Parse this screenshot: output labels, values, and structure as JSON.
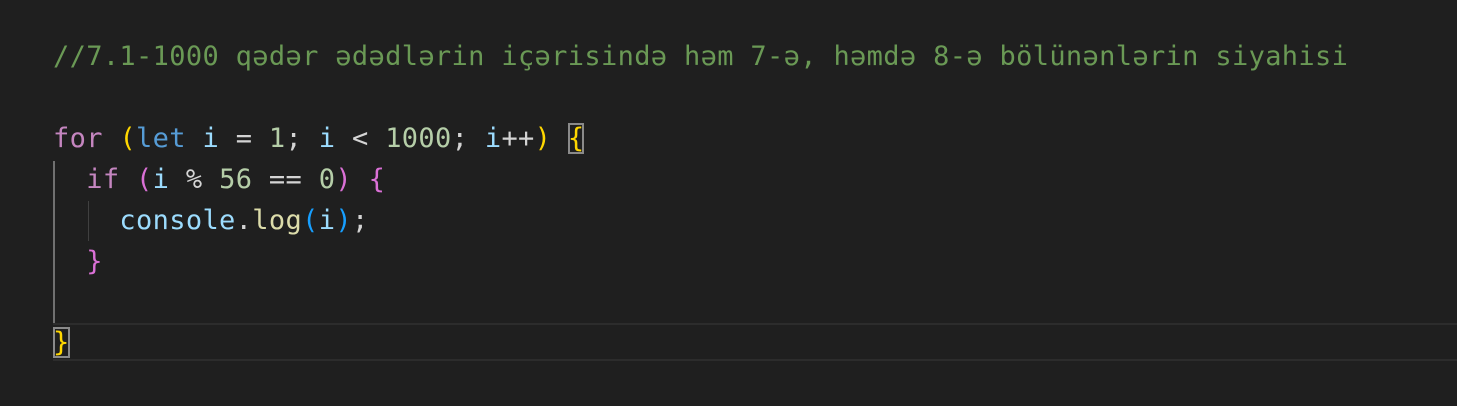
{
  "editor": {
    "background": "#1f1f1f",
    "lines": [
      {
        "name": "comment-line",
        "tokens": [
          {
            "text": "//7.1-1000 qədər ədədlərin içərisində həm 7-ə, həmdə 8-ə bölünənlərin siyahisi",
            "color": "#6a9955",
            "role": "comment"
          }
        ]
      },
      {
        "name": "for-line",
        "tokens": [
          {
            "text": "for",
            "color": "#c586c0",
            "role": "keyword"
          },
          {
            "text": " ",
            "color": "#d4d4d4",
            "role": "space"
          },
          {
            "text": "(",
            "color": "#ffd700",
            "role": "paren"
          },
          {
            "text": "let",
            "color": "#569cd6",
            "role": "keyword"
          },
          {
            "text": " ",
            "color": "#d4d4d4",
            "role": "space"
          },
          {
            "text": "i",
            "color": "#9cdcfe",
            "role": "variable"
          },
          {
            "text": " = ",
            "color": "#d4d4d4",
            "role": "operator"
          },
          {
            "text": "1",
            "color": "#b5cea8",
            "role": "number"
          },
          {
            "text": "; ",
            "color": "#d4d4d4",
            "role": "punct"
          },
          {
            "text": "i",
            "color": "#9cdcfe",
            "role": "variable"
          },
          {
            "text": " < ",
            "color": "#d4d4d4",
            "role": "operator"
          },
          {
            "text": "1000",
            "color": "#b5cea8",
            "role": "number"
          },
          {
            "text": "; ",
            "color": "#d4d4d4",
            "role": "punct"
          },
          {
            "text": "i",
            "color": "#9cdcfe",
            "role": "variable"
          },
          {
            "text": "++",
            "color": "#d4d4d4",
            "role": "operator"
          },
          {
            "text": ")",
            "color": "#ffd700",
            "role": "paren"
          },
          {
            "text": " ",
            "color": "#d4d4d4",
            "role": "space"
          },
          {
            "text": "{",
            "color": "#ffd700",
            "role": "brace-open",
            "matched": true
          }
        ]
      },
      {
        "name": "if-line",
        "tokens": [
          {
            "text": "  ",
            "color": "#d4d4d4",
            "role": "indent"
          },
          {
            "text": "if",
            "color": "#c586c0",
            "role": "keyword"
          },
          {
            "text": " ",
            "color": "#d4d4d4",
            "role": "space"
          },
          {
            "text": "(",
            "color": "#da70d6",
            "role": "paren"
          },
          {
            "text": "i",
            "color": "#9cdcfe",
            "role": "variable"
          },
          {
            "text": " % ",
            "color": "#d4d4d4",
            "role": "operator"
          },
          {
            "text": "56",
            "color": "#b5cea8",
            "role": "number"
          },
          {
            "text": " == ",
            "color": "#d4d4d4",
            "role": "operator"
          },
          {
            "text": "0",
            "color": "#b5cea8",
            "role": "number"
          },
          {
            "text": ")",
            "color": "#da70d6",
            "role": "paren"
          },
          {
            "text": " ",
            "color": "#d4d4d4",
            "role": "space"
          },
          {
            "text": "{",
            "color": "#da70d6",
            "role": "brace-open"
          }
        ]
      },
      {
        "name": "console-line",
        "tokens": [
          {
            "text": "    ",
            "color": "#d4d4d4",
            "role": "indent"
          },
          {
            "text": "console",
            "color": "#9cdcfe",
            "role": "variable"
          },
          {
            "text": ".",
            "color": "#d4d4d4",
            "role": "punct"
          },
          {
            "text": "log",
            "color": "#dcdcaa",
            "role": "function"
          },
          {
            "text": "(",
            "color": "#179fff",
            "role": "paren"
          },
          {
            "text": "i",
            "color": "#9cdcfe",
            "role": "variable"
          },
          {
            "text": ")",
            "color": "#179fff",
            "role": "paren"
          },
          {
            "text": ";",
            "color": "#d4d4d4",
            "role": "punct"
          }
        ]
      },
      {
        "name": "if-close-line",
        "tokens": [
          {
            "text": "  ",
            "color": "#d4d4d4",
            "role": "indent"
          },
          {
            "text": "}",
            "color": "#da70d6",
            "role": "brace-close"
          }
        ]
      },
      {
        "name": "empty-line",
        "tokens": []
      },
      {
        "name": "for-close-line",
        "tokens": [
          {
            "text": "}",
            "color": "#ffd700",
            "role": "brace-close",
            "matched": true
          }
        ]
      }
    ]
  }
}
